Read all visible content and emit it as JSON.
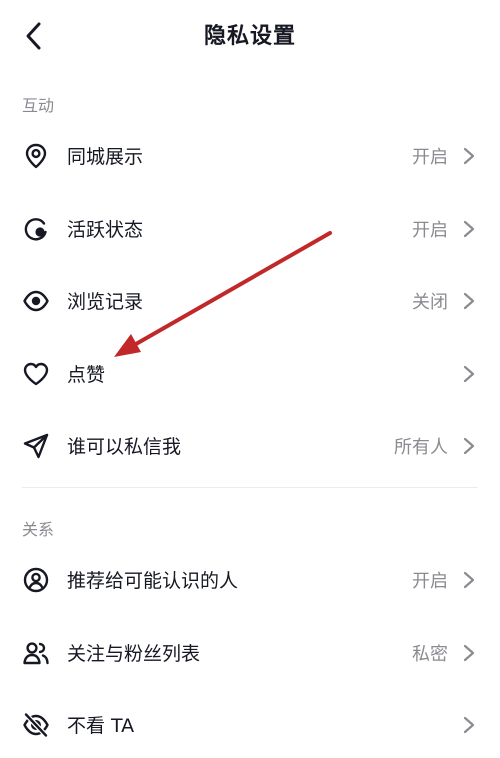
{
  "header": {
    "title": "隐私设置",
    "back_icon": "chevron-left-icon"
  },
  "sections": [
    {
      "label": "互动",
      "items": [
        {
          "label": "同城展示",
          "value": "开启",
          "icon": "location-pin-icon"
        },
        {
          "label": "活跃状态",
          "value": "开启",
          "icon": "activity-status-icon"
        },
        {
          "label": "浏览记录",
          "value": "关闭",
          "icon": "eye-icon"
        },
        {
          "label": "点赞",
          "value": "",
          "icon": "heart-icon"
        },
        {
          "label": "谁可以私信我",
          "value": "所有人",
          "icon": "send-icon"
        }
      ]
    },
    {
      "label": "关系",
      "items": [
        {
          "label": "推荐给可能认识的人",
          "value": "开启",
          "icon": "user-circle-icon"
        },
        {
          "label": "关注与粉丝列表",
          "value": "私密",
          "icon": "users-icon"
        },
        {
          "label": "不看 TA",
          "value": "",
          "icon": "eye-off-icon"
        }
      ]
    }
  ],
  "colors": {
    "text": "#161823",
    "secondary": "#8a8b91",
    "annotation_arrow": "#c0282a"
  }
}
